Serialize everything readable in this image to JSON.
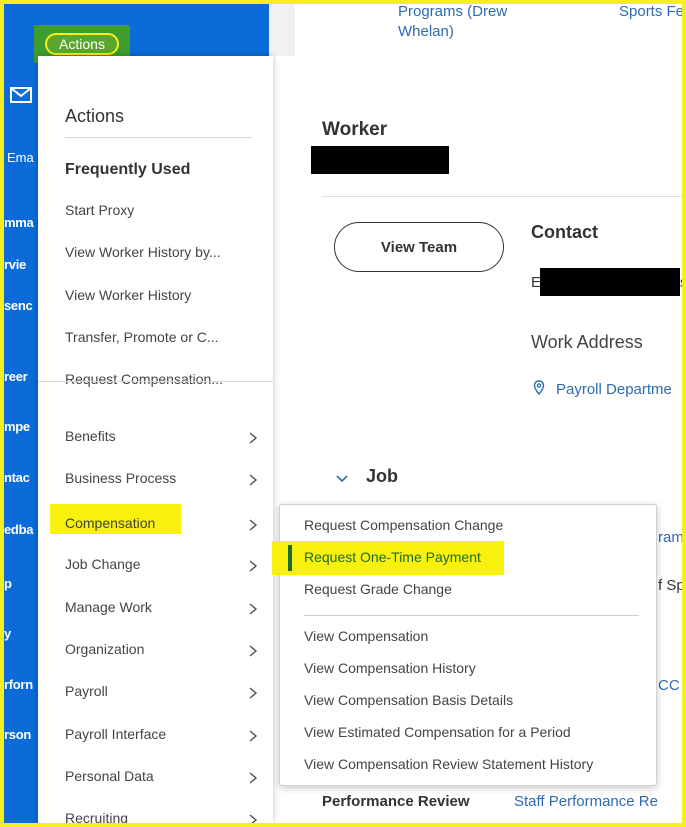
{
  "sidebar": {
    "actions_button": "Actions",
    "email_label": "Ema",
    "nav_labels": [
      "mma",
      "rvie",
      "senc",
      "reer",
      "mpe",
      "ntac",
      "edba",
      "p",
      "y",
      "rforn",
      "rson"
    ],
    "bg_color": "#0b6bd8"
  },
  "top_strip": {
    "link1": "Programs (Drew\nWhelan)",
    "link2": "Sports Fe"
  },
  "main": {
    "worker_title": "Worker",
    "view_team": "View Team",
    "contact_title": "Contact",
    "contact_prefix": "E",
    "contact_suffix": "s",
    "work_address": "Work Address",
    "payroll_link": "Payroll Departme",
    "job_title": "Job",
    "clip_ram": "ram",
    "clip_sp": "f Sp",
    "clip_cc": "CC",
    "performance_label": "Performance Review",
    "performance_link": "Staff Performance Re"
  },
  "actions_panel": {
    "heading": "Actions",
    "frequently_used_heading": "Frequently Used",
    "frequently_used": [
      "Start Proxy",
      "View Worker History by...",
      "View Worker History",
      "Transfer, Promote or C...",
      "Request Compensation..."
    ],
    "categories": [
      "Benefits",
      "Business Process",
      "Compensation",
      "Job Change",
      "Manage Work",
      "Organization",
      "Payroll",
      "Payroll Interface",
      "Personal Data",
      "Recruiting"
    ]
  },
  "compensation_submenu": {
    "items_group1": [
      "Request Compensation Change",
      "Request One-Time Payment",
      "Request Grade Change"
    ],
    "items_group2": [
      "View Compensation",
      "View Compensation History",
      "View Compensation Basis Details",
      "View Estimated Compensation for a Period",
      "View Compensation Review Statement History"
    ],
    "highlight_color": "#f8f10e",
    "active_bar_color": "#1f6a2c"
  },
  "colors": {
    "frame": "#f5ef22",
    "link": "#2e6ab1",
    "actions_green": "#3e9d2e"
  }
}
